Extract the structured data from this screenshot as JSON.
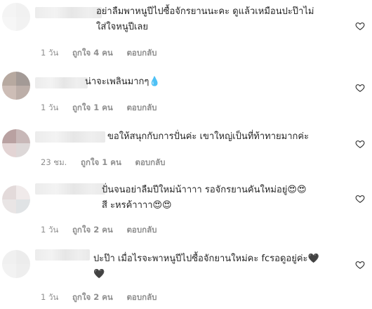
{
  "comments": [
    {
      "text": "อย่าลืมพาหนูปีไปซื้อจักรยานนะคะ ดูแล้วเหมือนปะป๊าไม่\nใส่ใจหนูปีเลย",
      "time": "1 วัน",
      "likes": "ถูกใจ 4 คน",
      "reply": "ตอบกลับ",
      "avatar_colors": [
        "#f4f4f4",
        "#f1f1f1",
        "#f6f6f6",
        "#f2f2f2"
      ]
    },
    {
      "text": "น่าจะเพลินมากๆ💧",
      "time": "1 วัน",
      "likes": "ถูกใจ 1 คน",
      "reply": "ตอบกลับ",
      "avatar_colors": [
        "#b7a9a0",
        "#a39a96",
        "#cdbdb6",
        "#bcaea8"
      ]
    },
    {
      "text": "ขอให้สนุกกับการปั่นค่ะ เขาใหญ่เป็นที่ท้าทายมากค่ะ",
      "time": "23 ชม.",
      "likes": "ถูกใจ 1 คน",
      "reply": "ตอบกลับ",
      "avatar_colors": [
        "#b9a1a1",
        "#c8b8b8",
        "#e3d4d4",
        "#ddd8d8"
      ]
    },
    {
      "text": "ปั่นจนอย่าลืมปีใหม่น้าาาา รอจักรยานคันใหม่อยู่😍😍\nสี ะหรค้าาาา😍😍",
      "time": "1 วัน",
      "likes": "ถูกใจ 2 คน",
      "reply": "ตอบกลับ",
      "avatar_colors": [
        "#e3dada",
        "#f0eaea",
        "#e9e5e5",
        "#e0e3e5"
      ]
    },
    {
      "text": "ปะป๊า เมื่อไรจะพาหนูปีไปซื้อจักยานใหม่คะ fcรอดูอยู่ค่ะ🖤\n🖤",
      "time": "1 วัน",
      "likes": "ถูกใจ 2 คน",
      "reply": "ตอบกลับ",
      "avatar_colors": [
        "#f0f0f0",
        "#ececec",
        "#f2f2f2",
        "#eeeeee"
      ]
    }
  ]
}
